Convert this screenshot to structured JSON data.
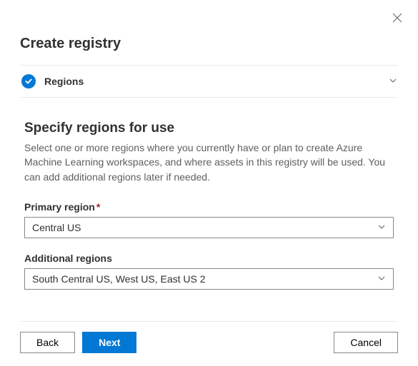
{
  "header": {
    "title": "Create registry"
  },
  "section": {
    "label": "Regions"
  },
  "content": {
    "heading": "Specify regions for use",
    "description": "Select one or more regions where you currently have or plan to create Azure Machine Learning workspaces, and where assets in this registry will be used. You can add additional regions later if needed.",
    "primary_label": "Primary region",
    "primary_value": "Central US",
    "additional_label": "Additional regions",
    "additional_value": "South Central US, West US, East US 2"
  },
  "footer": {
    "back": "Back",
    "next": "Next",
    "cancel": "Cancel"
  }
}
